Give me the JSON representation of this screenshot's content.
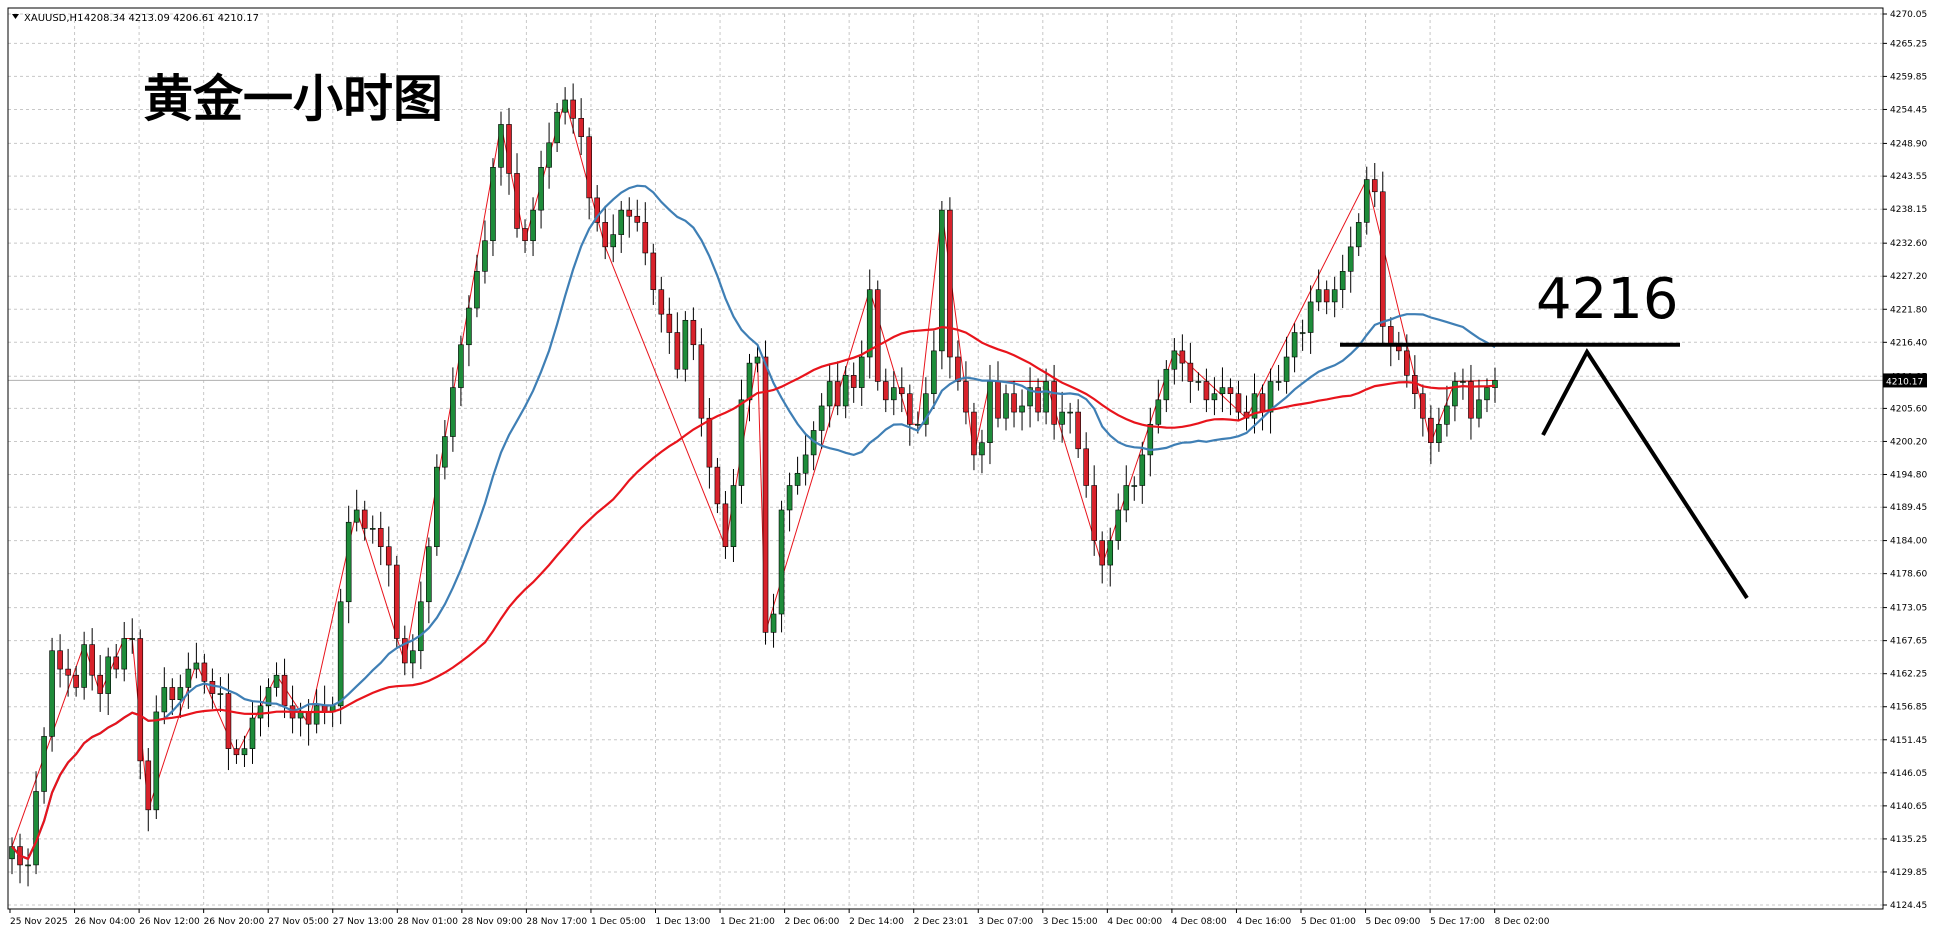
{
  "header": {
    "symbol": "XAUUSD,H1",
    "ohlc": "4208.34 4213.09 4206.61 4210.17"
  },
  "annotations": {
    "title": "黄金一小时图",
    "level_label": "4216"
  },
  "colors": {
    "bull_candle": "#1e8c3a",
    "bear_candle": "#d8222b",
    "wick": "#000000",
    "ma_fast": "#3f7fb5",
    "ma_slow": "#e8141c",
    "zigzag": "#e8141c",
    "grid": "#c8c8c8",
    "drawn_lines": "#000000"
  },
  "chart_data": {
    "type": "candlestick",
    "timeframe": "H1",
    "ylim": [
      4124.45,
      4270.05
    ],
    "yticks": [
      "4270.05",
      "4265.25",
      "4259.85",
      "4254.45",
      "4248.90",
      "4243.55",
      "4238.15",
      "4232.60",
      "4227.20",
      "4221.80",
      "4216.40",
      "4210.85",
      "4205.60",
      "4200.20",
      "4194.80",
      "4189.45",
      "4184.00",
      "4178.60",
      "4173.05",
      "4167.65",
      "4162.25",
      "4156.85",
      "4151.45",
      "4146.05",
      "4140.65",
      "4135.25",
      "4129.85",
      "4124.45"
    ],
    "last_price": "4210.17",
    "xticks": [
      "25 Nov 2025",
      "26 Nov 04:00",
      "26 Nov 12:00",
      "26 Nov 20:00",
      "27 Nov 05:00",
      "27 Nov 13:00",
      "28 Nov 01:00",
      "28 Nov 09:00",
      "28 Nov 17:00",
      "1 Dec 05:00",
      "1 Dec 13:00",
      "1 Dec 21:00",
      "2 Dec 06:00",
      "2 Dec 14:00",
      "2 Dec 23:01",
      "3 Dec 07:00",
      "3 Dec 15:00",
      "4 Dec 00:00",
      "4 Dec 08:00",
      "4 Dec 16:00",
      "5 Dec 01:00",
      "5 Dec 09:00",
      "5 Dec 17:00",
      "8 Dec 02:00"
    ],
    "grid": true,
    "closes": [
      4134,
      4131,
      4131,
      4143,
      4152,
      4166,
      4163,
      4162,
      4160,
      4167,
      4162,
      4159,
      4165,
      4163,
      4168,
      4168,
      4148,
      4140,
      4156,
      4160,
      4158,
      4160,
      4163,
      4164,
      4161,
      4159,
      4159,
      4150,
      4149,
      4150,
      4155,
      4157,
      4160,
      4162,
      4157,
      4155,
      4156,
      4154,
      4157,
      4156,
      4157,
      4174,
      4187,
      4189,
      4186,
      4186,
      4183,
      4180,
      4168,
      4164,
      4166,
      4174,
      4183,
      4196,
      4201,
      4209,
      4216,
      4222,
      4228,
      4233,
      4245,
      4252,
      4244,
      4235,
      4233,
      4238,
      4245,
      4249,
      4254,
      4256,
      4253,
      4250,
      4240,
      4236,
      4232,
      4234,
      4238,
      4237,
      4236,
      4231,
      4225,
      4221,
      4218,
      4212,
      4220,
      4216,
      4204,
      4196,
      4190,
      4183,
      4193,
      4207,
      4213,
      4214,
      4169,
      4172,
      4189,
      4193,
      4195,
      4198,
      4202,
      4206,
      4210,
      4206,
      4211,
      4209,
      4214,
      4225,
      4210,
      4207,
      4209,
      4208,
      4203,
      4203,
      4208,
      4215,
      4238,
      4214,
      4210,
      4205,
      4198,
      4200,
      4210,
      4204,
      4208,
      4205,
      4206,
      4209,
      4205,
      4210,
      4203,
      4205,
      4205,
      4199,
      4193,
      4184,
      4180,
      4184,
      4189,
      4193,
      4193,
      4198,
      4203,
      4207,
      4212,
      4215,
      4213,
      4210,
      4210,
      4207,
      4208,
      4209,
      4208,
      4205,
      4204,
      4208,
      4205,
      4210,
      4210,
      4214,
      4218,
      4218,
      4223,
      4225,
      4223,
      4225,
      4228,
      4232,
      4236,
      4243,
      4241,
      4219,
      4216,
      4215,
      4211,
      4208,
      4204,
      4200,
      4203,
      4206,
      4210,
      4210,
      4204,
      4207,
      4209,
      4210.17
    ]
  }
}
